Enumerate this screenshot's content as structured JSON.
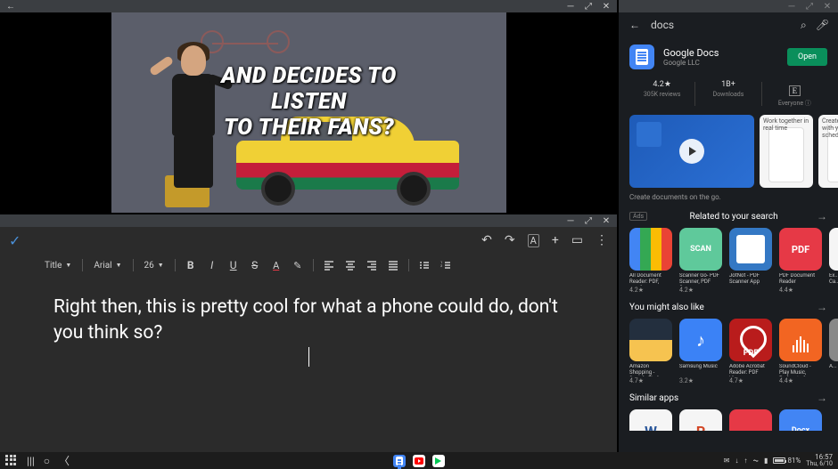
{
  "video": {
    "caption_line1": "AND DECIDES TO",
    "caption_line2": "LISTEN",
    "caption_line3": "TO THEIR FANS?"
  },
  "docs": {
    "toolbar": {
      "style": "Title",
      "font": "Arial",
      "size": "26"
    },
    "body_text": "Right then, this is pretty cool for what a phone could do, don't you think so?"
  },
  "store": {
    "search_query": "docs",
    "app": {
      "name": "Google Docs",
      "vendor": "Google LLC",
      "open_label": "Open",
      "rating": "4.2★",
      "reviews": "305K reviews",
      "downloads_top": "1B+",
      "downloads_bottom": "Downloads",
      "age_top": "E",
      "age_bottom": "Everyone ⓘ",
      "desc": "Create documents on the go.",
      "ss_caption1": "Work together in real time",
      "ss_caption2": "Create anywhere with your schedule does"
    },
    "sections": {
      "related_badge": "Ads",
      "related_title": "Related to your search",
      "like_title": "You might also like",
      "similar_title": "Similar apps"
    },
    "related": [
      {
        "name": "All Document Reader: PDF, excel...",
        "rating": "4.2★"
      },
      {
        "name": "Scanner Go- PDF Scanner, PDF Cre...",
        "rating": "4.2★"
      },
      {
        "name": "JotNot - PDF Scanner App",
        "rating": ""
      },
      {
        "name": "PDF Document Reader",
        "rating": "4.4★"
      },
      {
        "name": "Ex... Ca...",
        "rating": ""
      }
    ],
    "like": [
      {
        "name": "Amazon Shopping - Search, Find, Shi...",
        "rating": "4.7★"
      },
      {
        "name": "Samsung Music",
        "rating": "3.2★"
      },
      {
        "name": "Adobe Acrobat Reader: PDF View...",
        "rating": "4.7★"
      },
      {
        "name": "SoundCloud - Play Music, Podcasts &...",
        "rating": "4.4★"
      },
      {
        "name": "A...",
        "rating": ""
      }
    ]
  },
  "taskbar": {
    "net_down": "↓",
    "net_up": "↑",
    "wifi": "WiFi",
    "battery": "81%",
    "time": "16:57",
    "date": "Thu, 6/10"
  }
}
